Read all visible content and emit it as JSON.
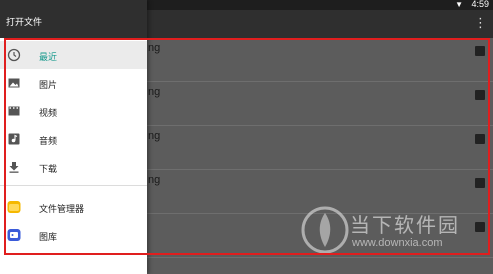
{
  "status": {
    "time": "4:59"
  },
  "drawer": {
    "title": "打开文件",
    "items": [
      {
        "label": "最近",
        "icon": "clock-icon"
      },
      {
        "label": "图片",
        "icon": "image-icon"
      },
      {
        "label": "视频",
        "icon": "video-icon"
      },
      {
        "label": "音频",
        "icon": "audio-icon"
      },
      {
        "label": "下载",
        "icon": "download-icon"
      },
      {
        "label": "文件管理器",
        "icon": "file-manager-icon"
      },
      {
        "label": "图库",
        "icon": "gallery-icon"
      }
    ]
  },
  "file_list": {
    "rows": [
      {
        "name_fragment": "ng"
      },
      {
        "name_fragment": "ng"
      },
      {
        "name_fragment": "ng"
      },
      {
        "name_fragment": "ng"
      },
      {
        "name_fragment": ""
      }
    ]
  },
  "watermark": {
    "text": "当下软件园",
    "url": "www.downxia.com"
  },
  "colors": {
    "accent": "#1a9b8e",
    "highlight": "#e01e1e"
  }
}
